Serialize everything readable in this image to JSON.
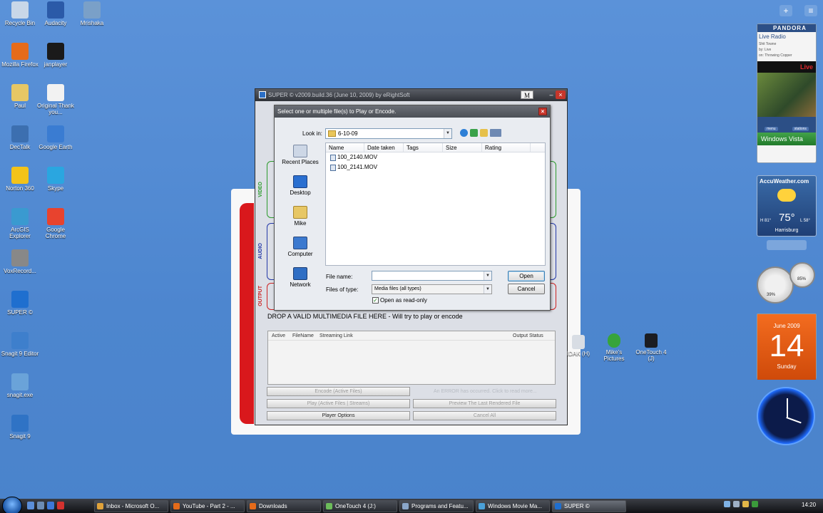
{
  "desktop_icons": [
    {
      "label": "Recycle Bin",
      "icon": "recycle-bin-icon"
    },
    {
      "label": "Audacity",
      "icon": "audacity-icon"
    },
    {
      "label": "Mrishaka",
      "icon": "app-icon"
    },
    {
      "label": "Mozilla Firefox",
      "icon": "firefox-icon"
    },
    {
      "label": "janplayer",
      "icon": "player-icon"
    },
    {
      "label": "Paul",
      "icon": "folder-icon"
    },
    {
      "label": "Original Thank you...",
      "icon": "audio-file-icon"
    },
    {
      "label": "DecTalk",
      "icon": "dectalk-icon"
    },
    {
      "label": "Google Earth",
      "icon": "google-earth-icon"
    },
    {
      "label": "Norton 360",
      "icon": "norton-icon"
    },
    {
      "label": "Skype",
      "icon": "skype-icon"
    },
    {
      "label": "ArcGIS Explorer",
      "icon": "arcgis-icon"
    },
    {
      "label": "Google Chrome",
      "icon": "chrome-icon"
    },
    {
      "label": "VoxRecord...",
      "icon": "voxrecord-icon"
    },
    {
      "label": "SUPER ©",
      "icon": "super-icon"
    },
    {
      "label": "Snagit 9 Editor",
      "icon": "snagit-editor-icon"
    },
    {
      "label": "snagit.exe",
      "icon": "snagit-exe-icon"
    },
    {
      "label": "Snagit 9",
      "icon": "snagit-icon"
    }
  ],
  "right_icons": [
    {
      "label": "IDAK (H)",
      "icon": "drive-icon"
    },
    {
      "label": "Mike's Pictures",
      "icon": "pictures-icon"
    },
    {
      "label": "OneTouch 4 (J)",
      "icon": "drive-icon"
    }
  ],
  "sidebar": {
    "plus": "+",
    "menu": "≡",
    "pandora": {
      "brand": "PANDORA",
      "mode": "Live Radio",
      "song": "Shit Towne",
      "by": "by: Live",
      "album": "on: Throwing Copper",
      "live_badge": "Live",
      "buttons": [
        "menu",
        "stations"
      ],
      "windows_vista": "Windows Vista"
    },
    "weather": {
      "brand": "AccuWeather.com",
      "temp": "75°",
      "high": "H 81°",
      "low": "L 58°",
      "city": "Harrisburg"
    },
    "calendar": {
      "month": "June 2009",
      "day": "14",
      "weekday": "Sunday"
    },
    "meter": {
      "cpu": "39%",
      "ram": "85%"
    }
  },
  "super_window": {
    "title": "SUPER © v2009.build.36 (June 10, 2009) by eRightSoft",
    "m_button": "M",
    "minimize": "–",
    "close": "×",
    "labels": {
      "video": "VIDEO",
      "audio": "AUDIO",
      "output": "OUTPUT"
    },
    "drop_text": "DROP A VALID MULTIMEDIA FILE HERE - Will try to play or encode",
    "table_headers": [
      "Active",
      "FileName",
      "Streaming Link",
      "Output Status"
    ],
    "buttons": {
      "encode": "Encode (Active Files)",
      "error": "An ERROR has occurred. Click to read more...",
      "play": "Play (Active Files | Streams)",
      "preview": "Preview The Last Rendered File",
      "player_options": "Player Options",
      "cancel_all": "Cancel All"
    }
  },
  "open_dialog": {
    "title": "Select one or multiple file(s) to Play or Encode.",
    "close": "×",
    "look_in_label": "Look in:",
    "look_in_value": "6-10-09",
    "places": [
      {
        "label": "Recent Places",
        "icon": "recent-places-icon"
      },
      {
        "label": "Desktop",
        "icon": "desktop-icon"
      },
      {
        "label": "Mike",
        "icon": "user-folder-icon"
      },
      {
        "label": "Computer",
        "icon": "computer-icon"
      },
      {
        "label": "Network",
        "icon": "network-icon"
      }
    ],
    "columns": [
      "Name",
      "Date taken",
      "Tags",
      "Size",
      "Rating"
    ],
    "files": [
      "100_2140.MOV",
      "100_2141.MOV"
    ],
    "file_name_label": "File name:",
    "file_name_value": "",
    "file_type_label": "Files of type:",
    "file_type_value": "Media files (all types)",
    "open_button": "Open",
    "cancel_button": "Cancel",
    "readonly_label": "Open as read-only",
    "readonly_checked": "✓"
  },
  "taskbar": {
    "tasks": [
      "Inbox - Microsoft O...",
      "YouTube - Part 2 - ...",
      "Downloads",
      "OneTouch 4 (J:)",
      "Programs and Featu...",
      "Windows Movie Ma...",
      "SUPER ©"
    ],
    "clock": "14:20"
  }
}
